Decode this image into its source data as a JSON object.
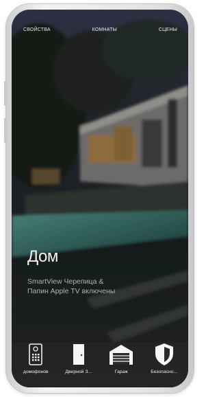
{
  "topbar": {
    "properties_label": "СВОЙСТВА",
    "rooms_label": "КОМНАТЫ",
    "scenes_label": "СЦЕНЫ"
  },
  "home": {
    "title": "Дом",
    "status_line1": "SmartView Черепица &",
    "status_line2": "Папин Apple TV включены"
  },
  "dock": {
    "items": [
      {
        "label": "домофонов",
        "icon": "intercom-icon"
      },
      {
        "label": "Дверной З...",
        "icon": "door-icon"
      },
      {
        "label": "Гараж",
        "icon": "garage-icon"
      },
      {
        "label": "Безопасно...",
        "icon": "shield-icon"
      }
    ]
  },
  "colors": {
    "status_text": "#a9b6b7",
    "dock_background": "#2a2c28"
  }
}
